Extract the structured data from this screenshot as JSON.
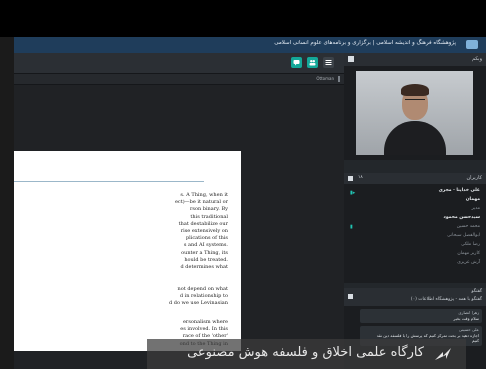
{
  "app": {
    "title": "پژوهشگاه فرهنگ و اندیشه اسلامی | برگزاری و برنامه‌های علوم انسانی اسلامی"
  },
  "toolbar": {
    "zoom_label": "Ottoman"
  },
  "document": {
    "paragraph1": [
      "s. A Thing, when it",
      "ect)—be it natural or",
      "rson binary. By",
      "this traditional",
      "that destabilize our",
      "rise extensively on",
      "plications of this",
      "s and AI systems.",
      "ounter a Thing, its",
      "hould be treated.",
      "d determines what"
    ],
    "paragraph2": [
      "not depend on what",
      "d in relationship to",
      "d do we use Levinasian"
    ],
    "paragraph3": [
      "ersonalism where",
      "es involved. In this",
      "race of the 'other'",
      "ond to the Thing in"
    ]
  },
  "video_panel": {
    "label": "وبکم"
  },
  "users_panel": {
    "label": "کاربران",
    "count": "۱۸",
    "users": [
      {
        "name": "علی خداپنا · مجری",
        "style": "bright"
      },
      {
        "name": "مهمان",
        "style": "bright"
      },
      {
        "name": "مدیر",
        "style": "dim"
      },
      {
        "name": "سیدحسن محمود",
        "style": "bright"
      },
      {
        "name": "محمد حسین",
        "style": "dim"
      },
      {
        "name": "ابوالفضل سبحانی",
        "style": "dim"
      },
      {
        "name": "رضا ملکی",
        "style": "dim"
      },
      {
        "name": "کاربر مهمان",
        "style": "dim"
      },
      {
        "name": "آرش عزیزی",
        "style": "dim"
      }
    ]
  },
  "chat_panel": {
    "label": "گفتگو",
    "subtitle": "گفتگو با همه - پژوهشگاه اطلاعات (۰)",
    "messages": [
      {
        "name": "زهرا انصاری",
        "text": "سلام وقت بخیر"
      },
      {
        "name": "علی حسینی",
        "text": "اجازه دهید بر بحث تمرکز کنیم که پرسش را با فلسفه دین نقد کنیم"
      }
    ]
  },
  "caption": {
    "text": "کارگاه علمی اخلاق و فلسفه هوش مصنوعی"
  },
  "colors": {
    "accent": "#14a899",
    "titlebar": "#1f3d5b"
  }
}
